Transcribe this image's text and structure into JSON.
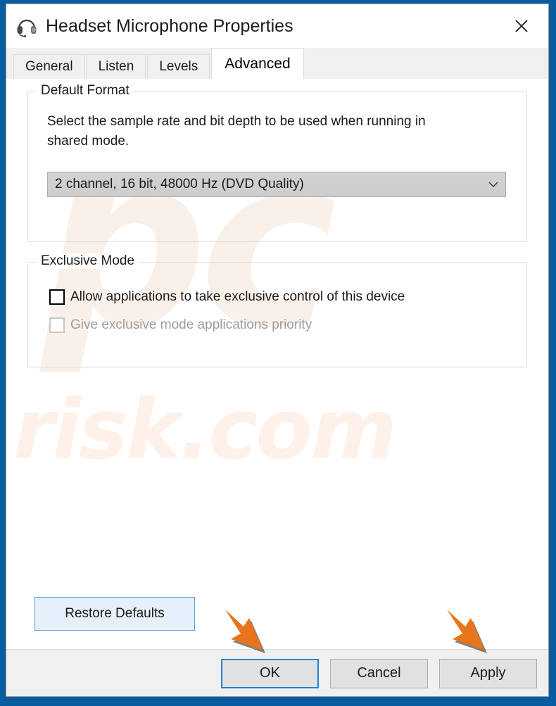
{
  "window": {
    "title": "Headset Microphone Properties",
    "icon": "headset-icon",
    "close_label": "✕",
    "accent_color": "#0a5ca0"
  },
  "tabs": [
    {
      "label": "General",
      "active": false
    },
    {
      "label": "Listen",
      "active": false
    },
    {
      "label": "Levels",
      "active": false
    },
    {
      "label": "Advanced",
      "active": true
    }
  ],
  "default_format": {
    "legend": "Default Format",
    "description": "Select the sample rate and bit depth to be used when running in shared mode.",
    "selected_value": "2 channel, 16 bit, 48000 Hz (DVD Quality)",
    "dropdown_icon": "chevron-down-icon"
  },
  "exclusive_mode": {
    "legend": "Exclusive Mode",
    "options": [
      {
        "label": "Allow applications to take exclusive control of this device",
        "checked": false,
        "disabled": false
      },
      {
        "label": "Give exclusive mode applications priority",
        "checked": false,
        "disabled": true
      }
    ]
  },
  "restore_defaults": {
    "label": "Restore Defaults"
  },
  "footer": {
    "ok_label": "OK",
    "cancel_label": "Cancel",
    "apply_label": "Apply"
  },
  "annotations": {
    "arrow_color": "#e8741c",
    "arrows": [
      {
        "name": "arrow-pointing-to-ok",
        "target": "OK"
      },
      {
        "name": "arrow-pointing-to-apply",
        "target": "Apply"
      }
    ]
  },
  "watermark": {
    "logo_text": "pc",
    "domain_text": "risk.com"
  }
}
